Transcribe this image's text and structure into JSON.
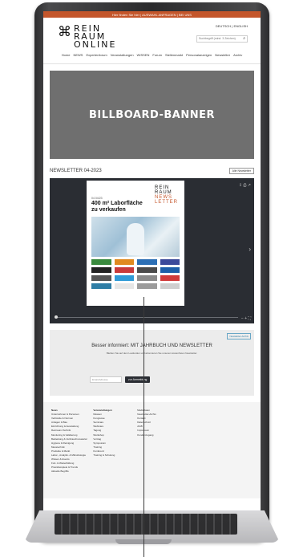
{
  "topbar": {
    "text": "Hier finden Sie hier | AUSWAHL ANFRAGEN | BEI UNS"
  },
  "logo": {
    "lines": [
      "REIN",
      "RAUM",
      "ONLINE"
    ],
    "mark": "⌘"
  },
  "header": {
    "lang": "DEUTSCH | ENGLISH",
    "search_placeholder": "Suchbegriff (mind. 3 Zeichen)"
  },
  "nav": {
    "items": [
      "Home",
      "NEWS",
      "Expertenforum",
      "Veranstaltungen",
      "WISSEN",
      "Forum",
      "Stellenmarkt",
      "Personalanzeigen",
      "Newsletter",
      "Archiv"
    ]
  },
  "banner": {
    "label": "BILLBOARD-BANNER"
  },
  "newsletter": {
    "title": "NEWSLETTER 04-2023",
    "all_button": "Alle Newsletter",
    "page": {
      "logo_lines": [
        "REIN",
        "RAUM",
        "NEWS",
        "LETTER"
      ],
      "issue": "04 04/23",
      "headline": "400 m² Laborfläche zu verkaufen"
    }
  },
  "signup": {
    "badge": "Newsletter-Archiv",
    "title": "Besser informiert: MIT JAHRBUCH UND NEWSLETTER",
    "text": "Bleiben Sie auf dem Laufenden und abonnieren Sie unseren kostenfreien Newsletter.",
    "input_placeholder": "Email-Adresse",
    "button_label": "zur Anmeldung"
  },
  "footer": {
    "col1": [
      "News",
      "Unternehmen & Personen",
      "Verbände & Normen",
      "Anlagen & Bau",
      "Einrichtung & Ausstattung",
      "Reinraum-Technik",
      "Monitoring & Validierung",
      "Bekleidung & Verbrauchsmaterial",
      "Hygiene & Reinigung",
      "Messtechnik",
      "Produkte & Markt",
      "Labor-, Analytik- & Mikrobiologie",
      "Wissen & Events",
      "Fort- & Weiterbildung",
      "Praxisbeispiele & Trends",
      "Aktuelle Begriffe"
    ],
    "col2": [
      "Veranstaltungen",
      "Messen",
      "Kongresse",
      "Seminare",
      "Webinare",
      "Tagung",
      "Workshop",
      "Vortrag",
      "Symposium",
      "Training",
      "Konferenz",
      "Training & Schulung"
    ],
    "col3": [
      "Mediadaten",
      "Newsletter-Archiv",
      "Kontakt",
      "Datenschutz",
      "AGB",
      "Impressum",
      "",
      "Kundenzugang"
    ]
  },
  "colors": {
    "accent": "#c4562b",
    "banner": "#6f6f6f",
    "viewer": "#2a2d33"
  }
}
